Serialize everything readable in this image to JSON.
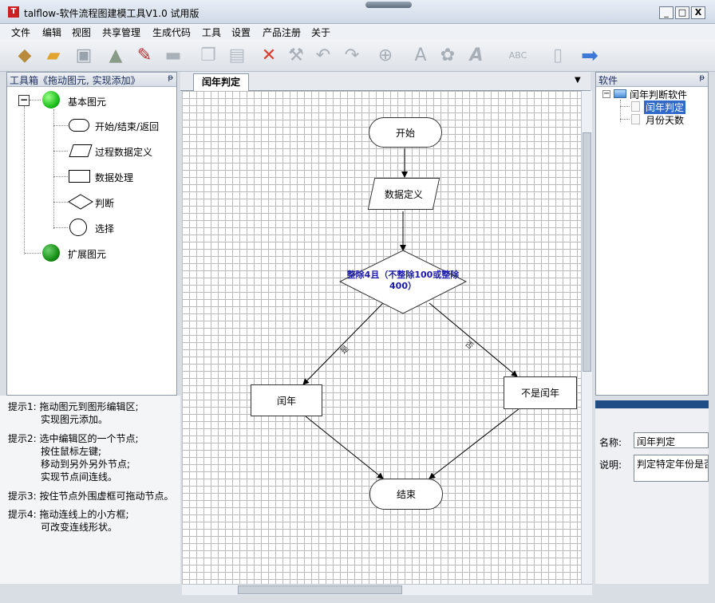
{
  "window": {
    "title": "talflow-软件流程图建模工具V1.0 试用版",
    "app_icon": "app-logo-icon",
    "min_label": "_",
    "max_label": "□",
    "close_label": "X"
  },
  "menu": [
    "文件",
    "编辑",
    "视图",
    "共享管理",
    "生成代码",
    "工具",
    "设置",
    "产品注册",
    "关于"
  ],
  "toolbar": {
    "icons": [
      "box-3d-icon",
      "folder-open-icon",
      "save-icon",
      "tree-icon",
      "edit-book-icon",
      "folder-icon",
      "copy-icon",
      "paste-icon",
      "delete-icon",
      "tools-icon",
      "undo-icon",
      "redo-icon",
      "zoom-icon",
      "font-icon",
      "palette-icon",
      "text-style-icon",
      "spellcheck-icon",
      "page-icon",
      "arrow-right-icon"
    ],
    "spell_label": "ABC"
  },
  "toolbox": {
    "title": "工具箱《拖动图元, 实现添加》",
    "pin": "ᵽ",
    "groups": [
      {
        "label": "基本图元",
        "expander": "−",
        "items": [
          "开始/结束/返回",
          "过程数据定义",
          "数据处理",
          "判断",
          "选择"
        ]
      },
      {
        "label": "扩展图元"
      }
    ]
  },
  "tips": [
    {
      "head": "提示1:",
      "lines": [
        "拖动图元到图形编辑区;",
        "实现图元添加。"
      ]
    },
    {
      "head": "提示2:",
      "lines": [
        "选中编辑区的一个节点;",
        "按住鼠标左键;",
        "移动到另外另外节点;",
        "实现节点间连线。"
      ]
    },
    {
      "head": "提示3:",
      "lines": [
        "按住节点外围虚框可拖动节点。"
      ]
    },
    {
      "head": "提示4:",
      "lines": [
        "拖动连线上的小方框;",
        "可改变连线形状。"
      ]
    }
  ],
  "editor": {
    "tab": "闰年判定",
    "dropdown": "▼"
  },
  "flow": {
    "start": "开始",
    "data": "数据定义",
    "decision": "整除4且（不整除100或整除400）",
    "yes_node": "闰年",
    "no_node": "不是闰年",
    "end": "结束",
    "edge_yes": "是",
    "edge_no": "否"
  },
  "software_pane": {
    "title": "软件",
    "pin": "ᵽ",
    "root": "闰年判断软件",
    "root_expander": "−",
    "children": [
      "闰年判定",
      "月份天数"
    ],
    "selected": "闰年判定"
  },
  "props": {
    "name_label": "名称:",
    "name_value": "闰年判定",
    "desc_label": "说明:",
    "desc_value": "判定特定年份是否"
  },
  "colors": {
    "decision_text": "#1a1aa8",
    "selection": "#3169c6",
    "props_bar": "#1f4e87"
  }
}
